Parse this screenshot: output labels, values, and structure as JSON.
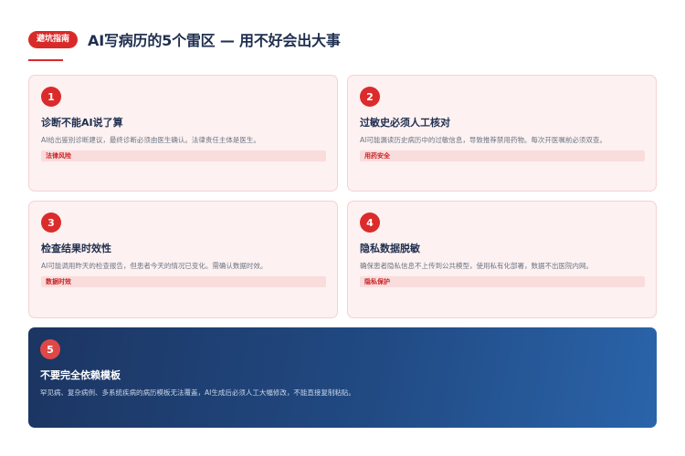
{
  "header": {
    "badge": "避坑指南",
    "title": "AI写病历的5个雷区 — 用不好会出大事"
  },
  "cards": [
    {
      "number": "1",
      "title": "诊断不能AI说了算",
      "description": "AI给出鉴别诊断建议，最终诊断必须由医生确认。法律责任主体是医生。",
      "tag": "法律风险"
    },
    {
      "number": "2",
      "title": "过敏史必须人工核对",
      "description": "AI可能漏读历史病历中的过敏信息，导致推荐禁用药物。每次开医嘱前必须双查。",
      "tag": "用药安全"
    },
    {
      "number": "3",
      "title": "检查结果时效性",
      "description": "AI可能调用昨天的检查报告，但患者今天的情况已变化。需确认数据时效。",
      "tag": "数据时效"
    },
    {
      "number": "4",
      "title": "隐私数据脱敏",
      "description": "确保患者隐私信息不上传到公共模型，使用私有化部署，数据不出医院内网。",
      "tag": "隐私保护"
    }
  ],
  "featured": {
    "number": "5",
    "title": "不要完全依赖模板",
    "description": "罕见病、复杂病例、多系统疾病的病历模板无法覆盖，AI生成后必须人工大幅修改，不能直接复制粘贴。"
  },
  "colors": {
    "accent": "#d92a2a",
    "navy": "#1f2f4f",
    "card_bg": "#fdf1f1",
    "featured_gradient_start": "#1c3562",
    "featured_gradient_end": "#2a64aa"
  }
}
